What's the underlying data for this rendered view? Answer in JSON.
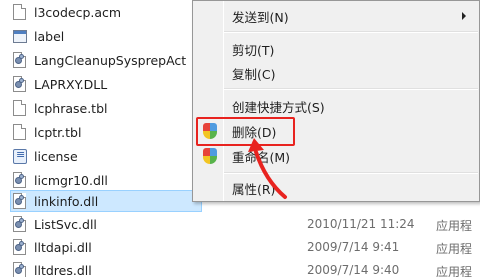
{
  "files": [
    {
      "name": "l3codecp.acm",
      "icon": "document-icon",
      "date": "",
      "type": ""
    },
    {
      "name": "label",
      "icon": "window-icon",
      "date": "",
      "type": ""
    },
    {
      "name": "LangCleanupSysprepAct",
      "icon": "dll-icon",
      "date": "",
      "type": ""
    },
    {
      "name": "LAPRXY.DLL",
      "icon": "dll-icon",
      "date": "",
      "type": ""
    },
    {
      "name": "lcphrase.tbl",
      "icon": "document-icon",
      "date": "",
      "type": ""
    },
    {
      "name": "lcptr.tbl",
      "icon": "document-icon",
      "date": "",
      "type": ""
    },
    {
      "name": "license",
      "icon": "license-icon",
      "date": "",
      "type": ""
    },
    {
      "name": "licmgr10.dll",
      "icon": "dll-icon",
      "date": "",
      "type": ""
    },
    {
      "name": "linkinfo.dll",
      "icon": "dll-icon",
      "date": "",
      "type": "",
      "selected": true
    },
    {
      "name": "ListSvc.dll",
      "icon": "dll-icon",
      "date": "2010/11/21 11:24",
      "type": "应用程"
    },
    {
      "name": "lltdapi.dll",
      "icon": "dll-icon",
      "date": "2009/7/14 9:41",
      "type": "应用程"
    },
    {
      "name": "lltdres.dll",
      "icon": "dll-icon",
      "date": "2009/7/14 9:40",
      "type": "应用程"
    }
  ],
  "context_menu": {
    "items": [
      {
        "label": "发送到(N)",
        "submenu": true
      },
      {
        "label": "剪切(T)"
      },
      {
        "label": "复制(C)"
      },
      {
        "label": "创建快捷方式(S)"
      },
      {
        "label": "删除(D)",
        "shield": true,
        "highlighted": true
      },
      {
        "label": "重命名(M)",
        "shield": true
      },
      {
        "label": "属性(R)"
      }
    ]
  },
  "annotation_color": "#e8231f"
}
